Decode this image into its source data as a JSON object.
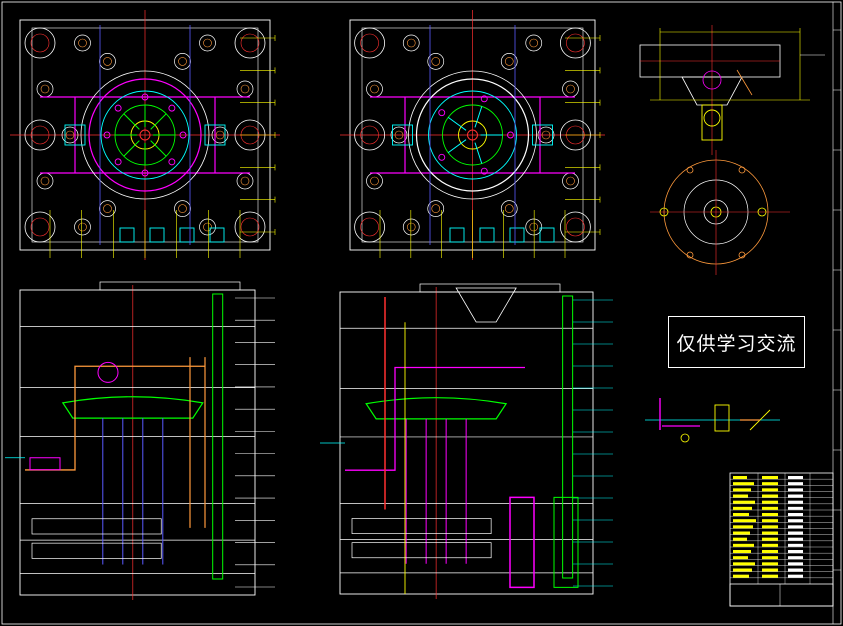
{
  "viewport": {
    "background": "#000000"
  },
  "watermark": {
    "text": "仅供学习交流"
  },
  "colors": {
    "frame": "#ffffff",
    "centerline": "#ff3030",
    "outline_yellow": "#ffff00",
    "outline_cyan": "#00ffff",
    "outline_magenta": "#ff00ff",
    "outline_green": "#00ff00",
    "outline_orange": "#ff9a3c",
    "outline_blue": "#5a5aff"
  },
  "views": [
    {
      "name": "moving-half-plan-view",
      "kind": "plan"
    },
    {
      "name": "fixed-half-plan-view",
      "kind": "plan"
    },
    {
      "name": "sprue-bushing-detail",
      "kind": "detail"
    },
    {
      "name": "locating-ring-detail",
      "kind": "detail"
    },
    {
      "name": "mold-section-view-left",
      "kind": "section"
    },
    {
      "name": "mold-section-view-right",
      "kind": "section"
    },
    {
      "name": "ejector-detail",
      "kind": "detail"
    },
    {
      "name": "title-block",
      "kind": "table"
    }
  ]
}
